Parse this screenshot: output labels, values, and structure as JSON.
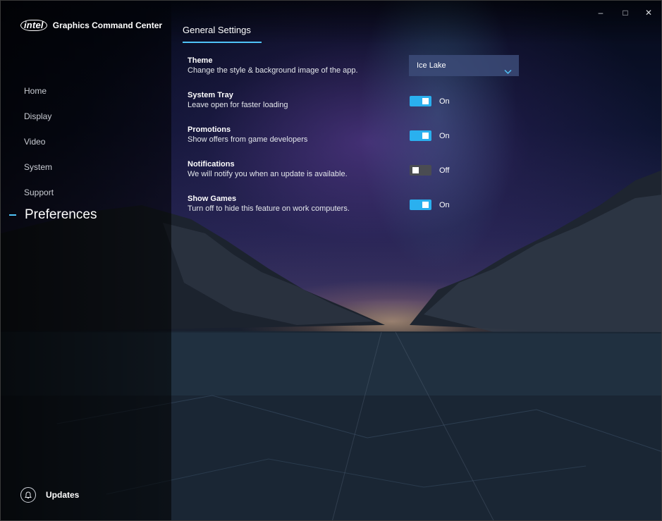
{
  "app": {
    "brand": "intel",
    "title": "Graphics Command Center"
  },
  "window_controls": {
    "minimize": "–",
    "maximize": "□",
    "close": "✕"
  },
  "sidebar": {
    "items": [
      {
        "label": "Home"
      },
      {
        "label": "Display"
      },
      {
        "label": "Video"
      },
      {
        "label": "System"
      },
      {
        "label": "Support"
      }
    ],
    "active_item": "Preferences",
    "updates_label": "Updates"
  },
  "main": {
    "tab_label": "General Settings",
    "settings": {
      "theme": {
        "title": "Theme",
        "description": "Change the style & background image of the app.",
        "selected_value": "Ice Lake"
      },
      "system_tray": {
        "title": "System Tray",
        "description": "Leave open for faster loading",
        "state_label": "On",
        "enabled": true
      },
      "promotions": {
        "title": "Promotions",
        "description": "Show offers from game developers",
        "state_label": "On",
        "enabled": true
      },
      "notifications": {
        "title": "Notifications",
        "description": "We will notify you when an update is available.",
        "state_label": "Off",
        "enabled": false
      },
      "show_games": {
        "title": "Show Games",
        "description": "Turn off to hide this feature on work computers.",
        "state_label": "On",
        "enabled": true
      }
    }
  },
  "colors": {
    "accent": "#2ab0ef",
    "toggle_off": "#4a4c52",
    "dropdown_bg": "#3c4b78"
  },
  "icons": {
    "bell": "bell-icon",
    "dropdown": "chevron-down-icon",
    "logo": "intel-logo"
  }
}
